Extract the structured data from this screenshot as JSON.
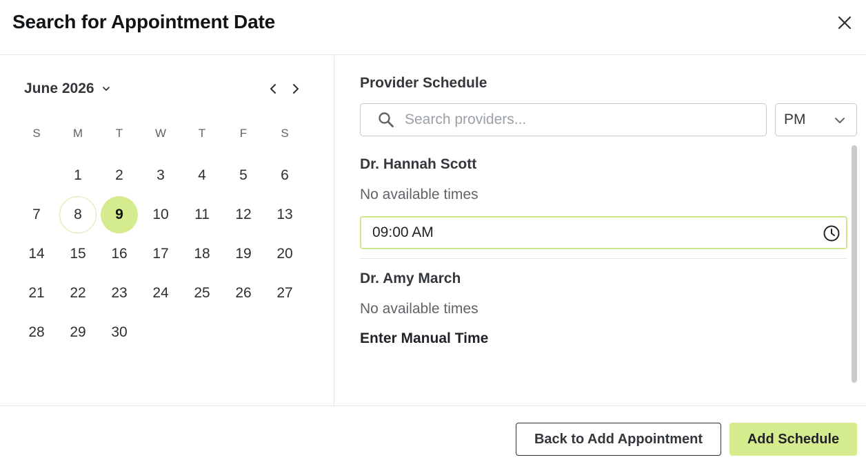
{
  "dialog": {
    "title": "Search for Appointment Date",
    "close_icon": "close-icon"
  },
  "calendar": {
    "month_label": "June 2026",
    "weekdays": [
      "S",
      "M",
      "T",
      "W",
      "T",
      "F",
      "S"
    ],
    "weeks": [
      [
        "",
        "1",
        "2",
        "3",
        "4",
        "5",
        "6"
      ],
      [
        "7",
        "8",
        "9",
        "10",
        "11",
        "12",
        "13"
      ],
      [
        "14",
        "15",
        "16",
        "17",
        "18",
        "19",
        "20"
      ],
      [
        "21",
        "22",
        "23",
        "24",
        "25",
        "26",
        "27"
      ],
      [
        "28",
        "29",
        "30",
        "",
        "",
        "",
        ""
      ]
    ],
    "today": "8",
    "selected": "9",
    "prev_icon": "chevron-left-icon",
    "next_icon": "chevron-right-icon"
  },
  "schedule": {
    "title": "Provider Schedule",
    "search_placeholder": "Search providers...",
    "search_value": "",
    "period": "PM",
    "providers": [
      {
        "name": "Dr. Hannah Scott",
        "status": "No available times"
      },
      {
        "name": "Dr. Amy March",
        "status": "No available times"
      }
    ],
    "time_value": "09:00 AM",
    "manual_time_label": "Enter Manual Time"
  },
  "footer": {
    "back_label": "Back to Add Appointment",
    "add_label": "Add Schedule"
  },
  "colors": {
    "accent": "#d5ec8e",
    "accent_border": "#cfe88a",
    "text": "#33373b"
  }
}
